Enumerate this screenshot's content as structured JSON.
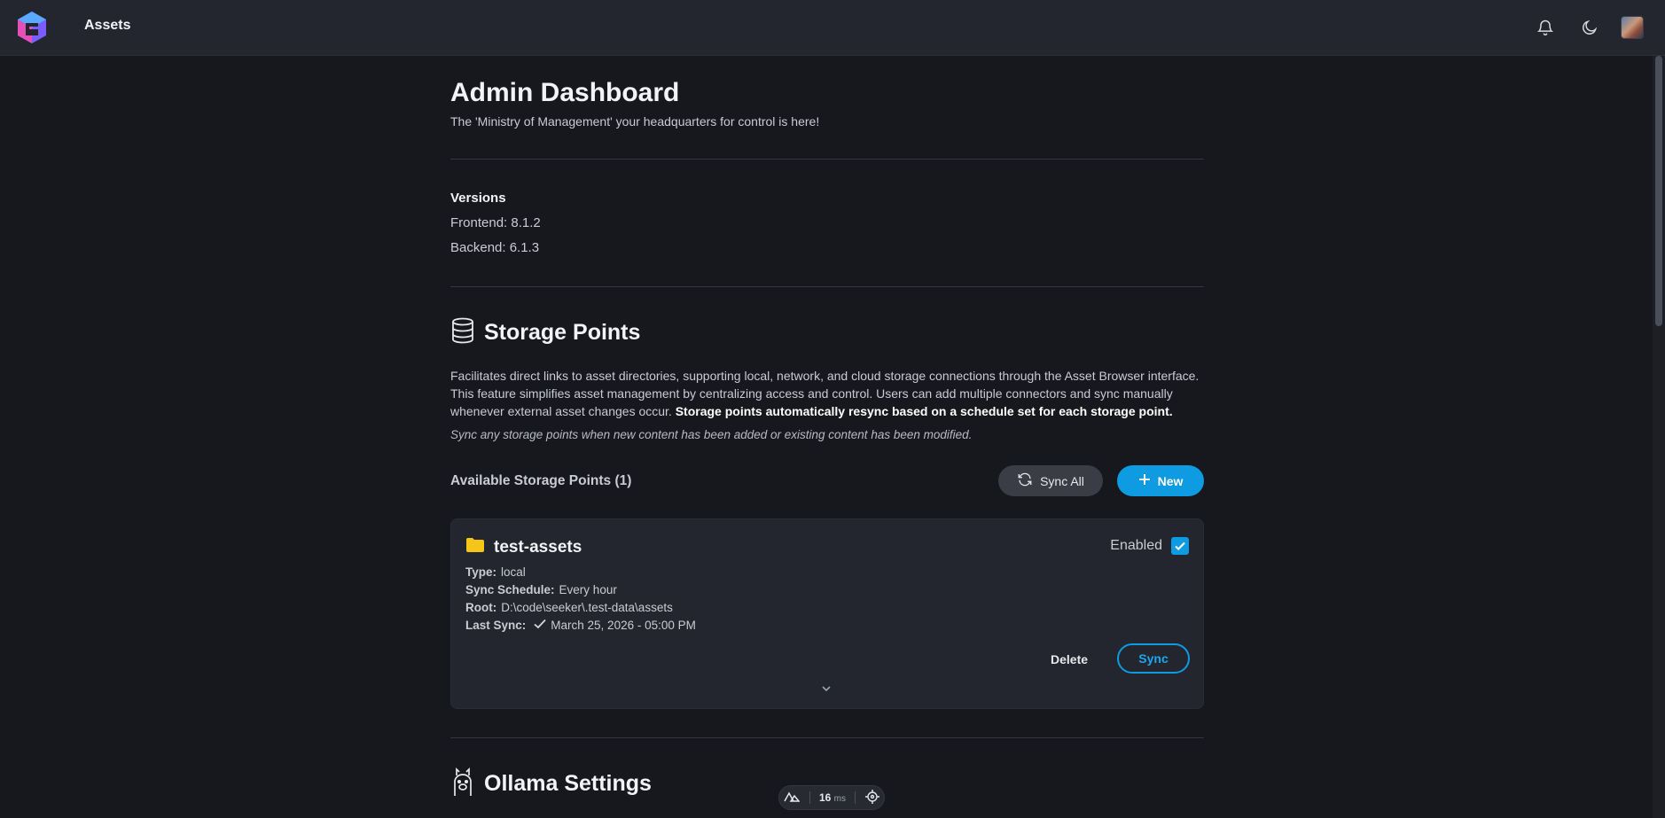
{
  "header": {
    "title": "Assets",
    "icons": [
      "bell-icon",
      "moon-icon",
      "avatar"
    ]
  },
  "page": {
    "title": "Admin Dashboard",
    "subtitle": "The 'Ministry of Management' your headquarters for control is here!"
  },
  "versions": {
    "title": "Versions",
    "frontend": "Frontend: 8.1.2",
    "backend": "Backend: 6.1.3"
  },
  "storage": {
    "title": "Storage Points",
    "description": "Facilitates direct links to asset directories, supporting local, network, and cloud storage connections through the Asset Browser interface. This feature simplifies asset management by centralizing access and control. Users can add multiple connectors and sync manually whenever external asset changes occur.",
    "description_bold": "Storage points automatically resync based on a schedule set for each storage point.",
    "note": "Sync any storage points when new content has been added or existing content has been modified.",
    "available_label": "Available Storage Points (1)",
    "sync_all_label": "Sync All",
    "new_label": "New",
    "items": [
      {
        "name": "test-assets",
        "enabled_label": "Enabled",
        "enabled": true,
        "type_key": "Type:",
        "type_value": "local",
        "schedule_key": "Sync Schedule:",
        "schedule_value": "Every hour",
        "root_key": "Root:",
        "root_value": "D:\\code\\seeker\\.test-data\\assets",
        "last_sync_key": "Last Sync:",
        "last_sync_value": "March 25, 2026 - 05:00 PM",
        "delete_label": "Delete",
        "sync_label": "Sync"
      }
    ]
  },
  "ollama": {
    "title": "Ollama Settings"
  },
  "devbar": {
    "ms_value": "16",
    "ms_unit": "ms"
  },
  "colors": {
    "accent": "#0e9be1",
    "background": "#17181d",
    "topbar": "#23262e",
    "card": "#23262e",
    "folder": "#f5c518"
  }
}
